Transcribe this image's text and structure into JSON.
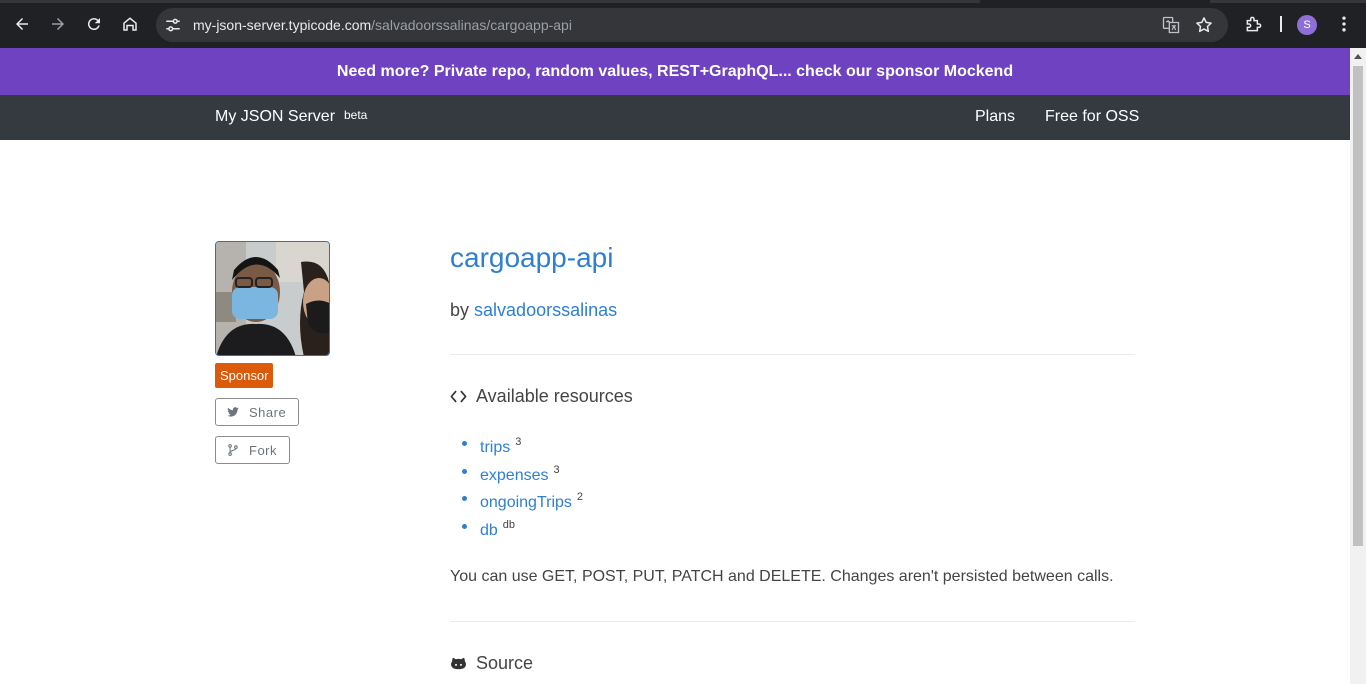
{
  "browser": {
    "url_host": "my-json-server.typicode.com",
    "url_path": "/salvadoorssalinas/cargoapp-api",
    "profile_initial": "S"
  },
  "banner": {
    "text": "Need more? Private repo, random values, REST+GraphQL... check our sponsor Mockend"
  },
  "navbar": {
    "brand": "My JSON Server",
    "beta": "beta",
    "links": [
      "Plans",
      "Free for OSS"
    ]
  },
  "sidebar": {
    "sponsor_label": "Sponsor",
    "share_label": "Share",
    "fork_label": "Fork"
  },
  "repo": {
    "title": "cargoapp-api",
    "by_prefix": "by",
    "owner": "salvadoorssalinas"
  },
  "resources": {
    "heading": "Available resources",
    "items": [
      {
        "name": "trips",
        "count": "3"
      },
      {
        "name": "expenses",
        "count": "3"
      },
      {
        "name": "ongoingTrips",
        "count": "2"
      },
      {
        "name": "db",
        "count": "db"
      }
    ],
    "note": "You can use GET, POST, PUT, PATCH and DELETE. Changes aren't persisted between calls."
  },
  "source": {
    "heading": "Source"
  },
  "colors": {
    "banner": "#6f42c1",
    "navbar": "#343a40",
    "link": "#2f7fd1",
    "sponsor_badge": "#dc5b0a"
  }
}
